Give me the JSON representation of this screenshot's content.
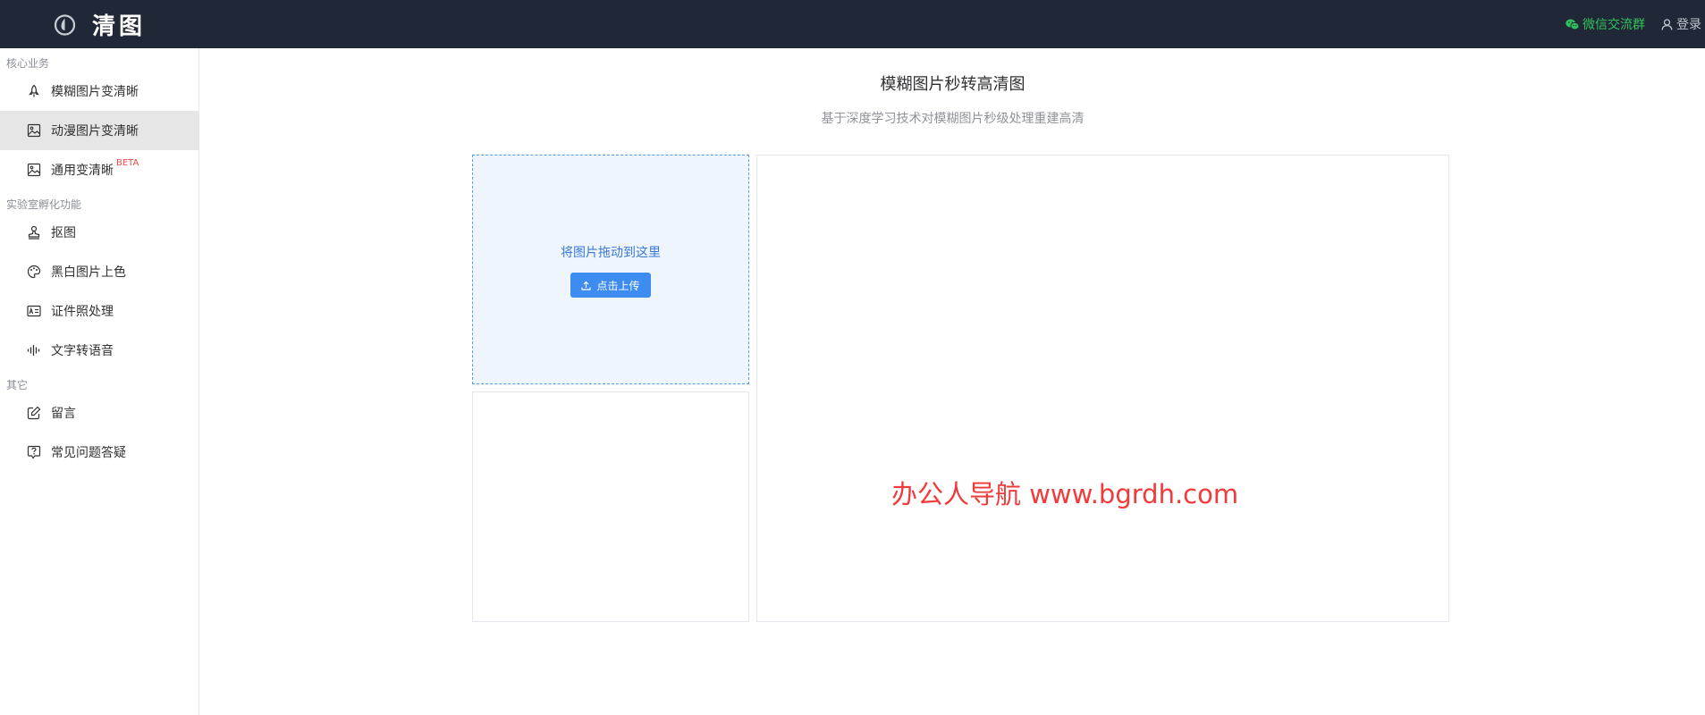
{
  "header": {
    "logo_text": "清图",
    "logo_icon": "drop-icon",
    "wechat_label": "微信交流群",
    "wechat_icon": "wechat-icon",
    "login_label": "登录",
    "login_icon": "user-icon",
    "bg_color": "#202837",
    "wechat_color": "#2fc25b"
  },
  "sidebar": {
    "groups": [
      {
        "title": "核心业务",
        "items": [
          {
            "label": "模糊图片变清晰",
            "icon": "rocket-icon",
            "active": false
          },
          {
            "label": "动漫图片变清晰",
            "icon": "picture-icon",
            "active": true
          },
          {
            "label": "通用变清晰",
            "icon": "picture-icon",
            "badge": "BETA",
            "active": false
          }
        ]
      },
      {
        "title": "实验室孵化功能",
        "items": [
          {
            "label": "抠图",
            "icon": "stamp-icon",
            "active": false
          },
          {
            "label": "黑白图片上色",
            "icon": "palette-icon",
            "active": false
          },
          {
            "label": "证件照处理",
            "icon": "id-card-icon",
            "active": false
          },
          {
            "label": "文字转语音",
            "icon": "waveform-icon",
            "active": false
          }
        ]
      },
      {
        "title": "其它",
        "items": [
          {
            "label": "留言",
            "icon": "edit-icon",
            "active": false
          },
          {
            "label": "常见问题答疑",
            "icon": "question-icon",
            "active": false
          }
        ]
      }
    ]
  },
  "main": {
    "title": "模糊图片秒转高清图",
    "subtitle": "基于深度学习技术对模糊图片秒级处理重建高清",
    "upload": {
      "drag_hint": "将图片拖动到这里",
      "button_label": "点击上传",
      "button_icon": "upload-icon"
    },
    "watermark": "办公人导航 www.bgrdh.com",
    "accent_color": "#3f8cf0",
    "watermark_color": "#f23a3a"
  }
}
